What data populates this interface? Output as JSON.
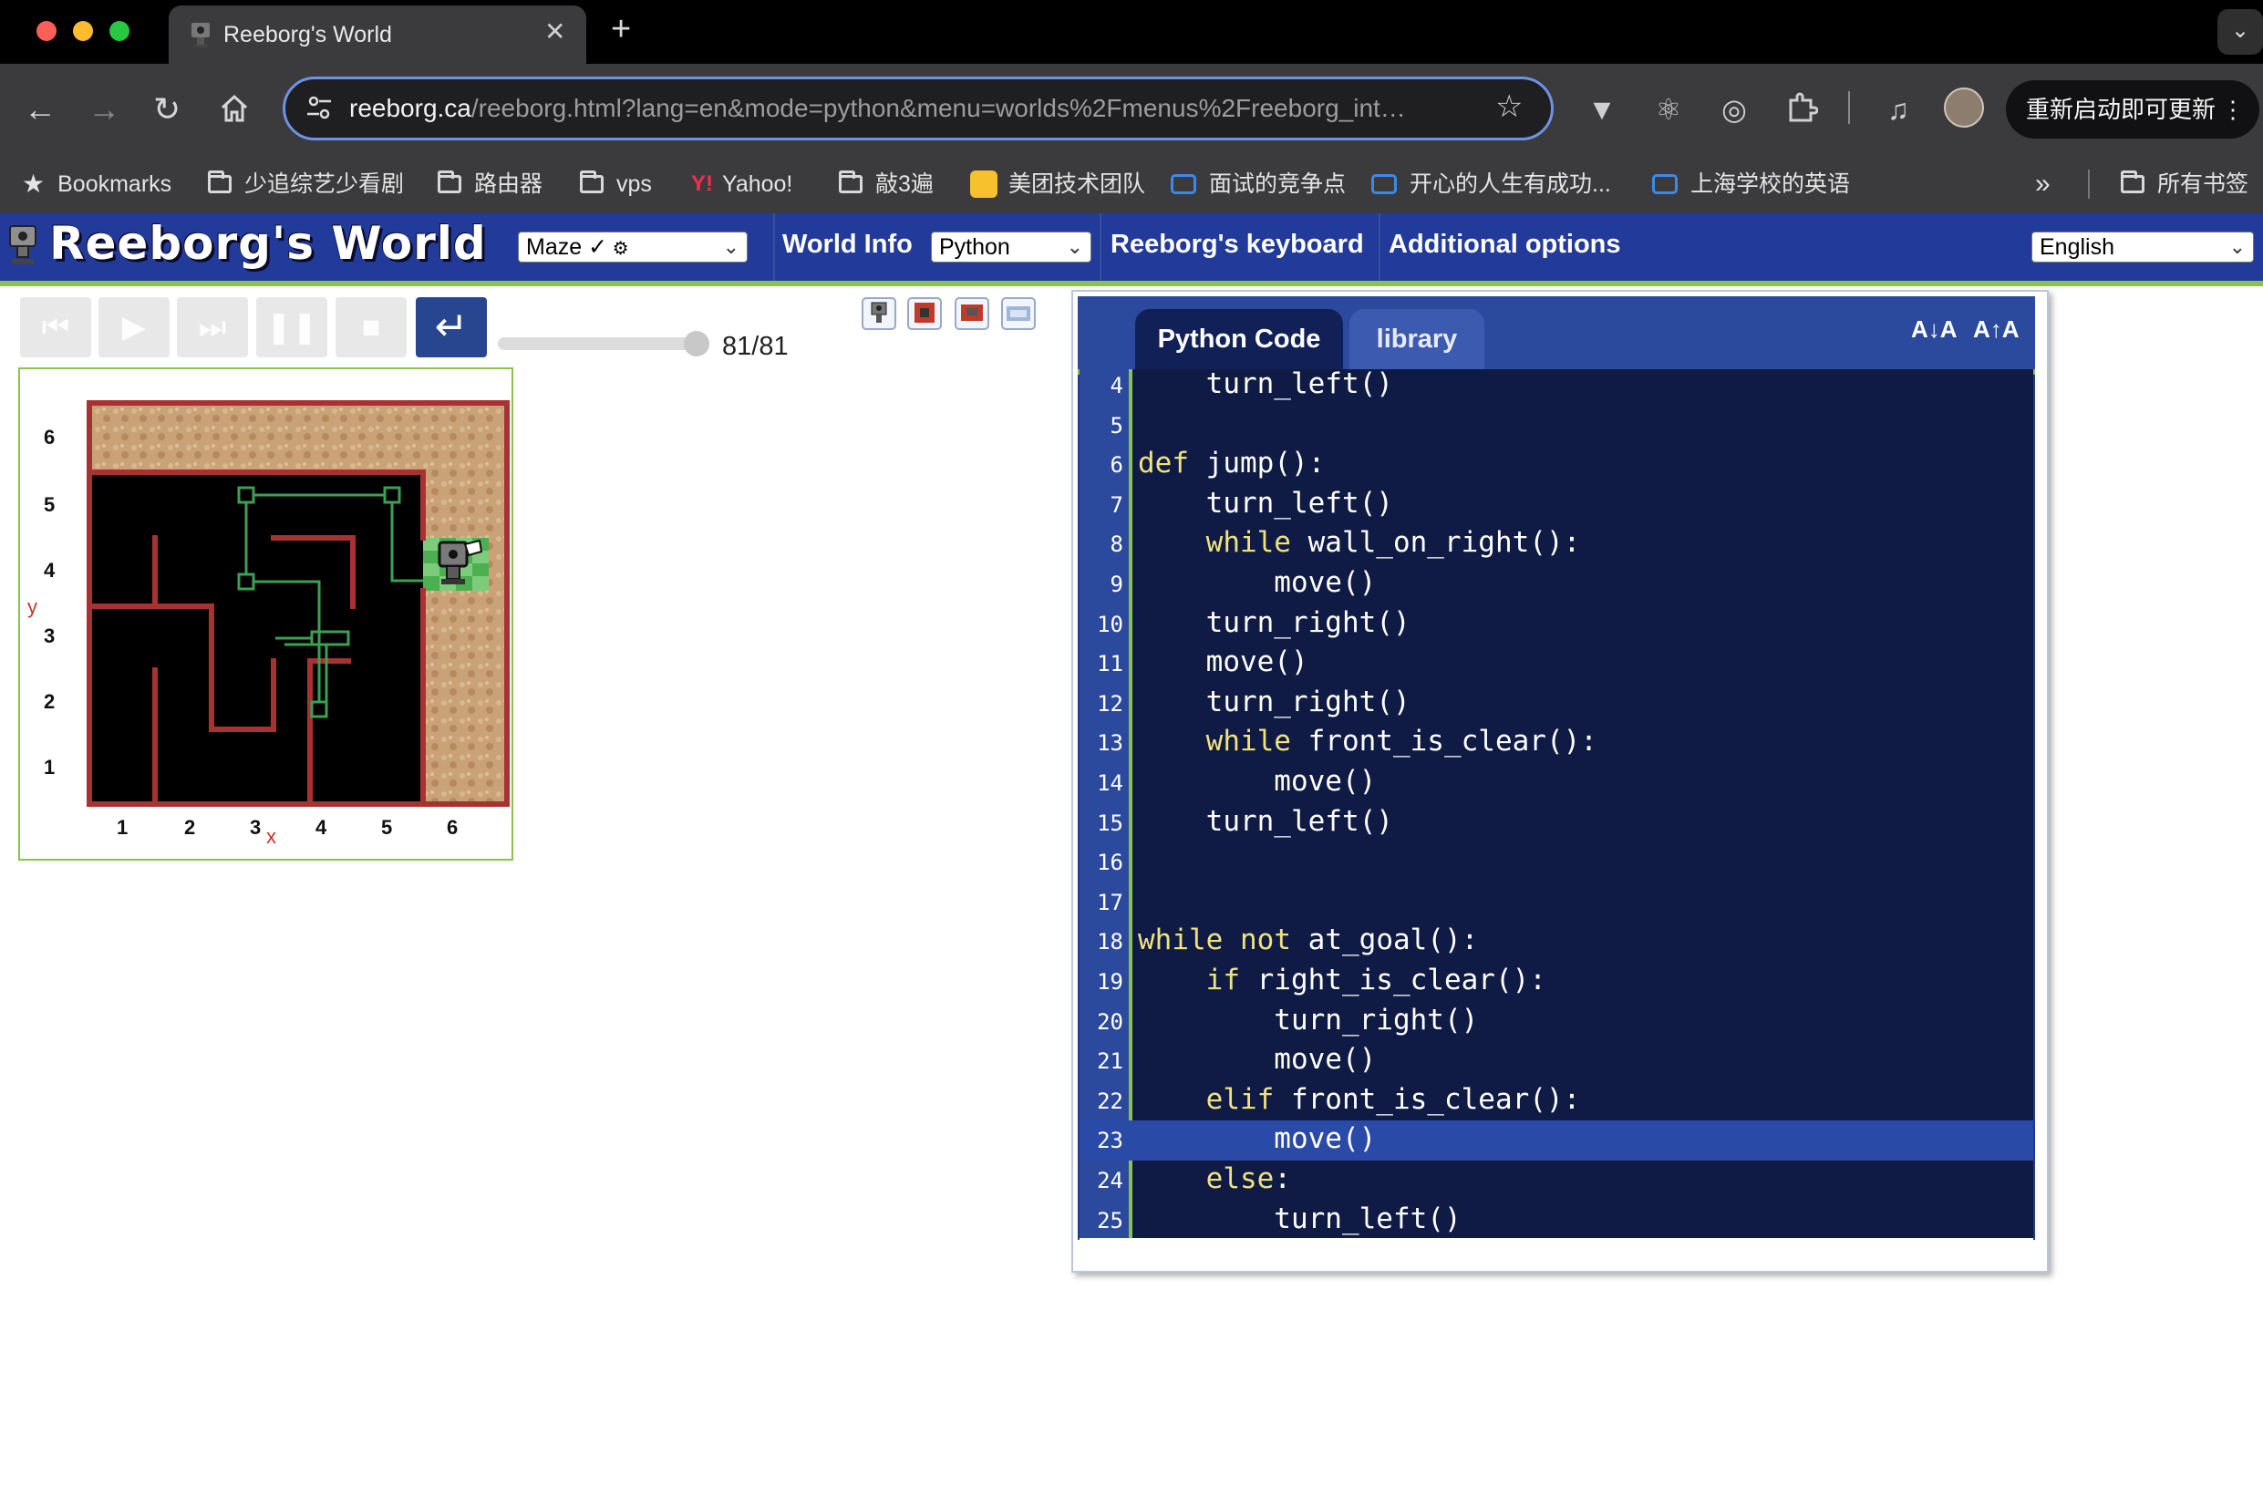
{
  "browser": {
    "tab_title": "Reeborg's World",
    "url_host": "reeborg.ca",
    "url_path": "/reeborg.html?lang=en&mode=python&menu=worlds%2Fmenus%2Freeborg_int…",
    "update_button": "重新启动即可更新",
    "bookmarks": [
      "Bookmarks",
      "少追综艺少看剧",
      "路由器",
      "vps",
      "Yahoo!",
      "敲3遍",
      "美团技术团队",
      "面试的竞争点",
      "开心的人生有成功...",
      "上海学校的英语",
      "所有书签"
    ],
    "overflow_label": "»"
  },
  "app": {
    "logo": "Reeborg's World",
    "world_select": "Maze ✓",
    "world_info": "World Info",
    "language_mode": "Python",
    "keyboard": "Reeborg's keyboard",
    "options": "Additional options",
    "ui_language": "English"
  },
  "controls": {
    "step_counter": "81/81",
    "step_value": 81,
    "step_total": 81
  },
  "world": {
    "y_labels": [
      "6",
      "5",
      "4",
      "3",
      "2",
      "1"
    ],
    "x_labels": [
      "1",
      "2",
      "3",
      "4",
      "5",
      "6"
    ],
    "x_axis": "x",
    "y_axis": "y"
  },
  "editor": {
    "tab_code": "Python Code",
    "tab_library": "library",
    "font_down": "A↓A",
    "font_up": "A↑A",
    "highlighted_line": 23,
    "lines": [
      {
        "n": "4",
        "segs": [
          [
            "",
            "    turn_left()"
          ]
        ]
      },
      {
        "n": "5",
        "segs": [
          [
            "",
            ""
          ]
        ]
      },
      {
        "n": "6",
        "segs": [
          [
            "kw",
            "def"
          ],
          [
            "",
            " jump():"
          ]
        ]
      },
      {
        "n": "7",
        "segs": [
          [
            "",
            "    turn_left()"
          ]
        ]
      },
      {
        "n": "8",
        "segs": [
          [
            "",
            "    "
          ],
          [
            "kw",
            "while"
          ],
          [
            "",
            " wall_on_right():"
          ]
        ]
      },
      {
        "n": "9",
        "segs": [
          [
            "",
            "        move()"
          ]
        ]
      },
      {
        "n": "10",
        "segs": [
          [
            "",
            "    turn_right()"
          ]
        ]
      },
      {
        "n": "11",
        "segs": [
          [
            "",
            "    move()"
          ]
        ]
      },
      {
        "n": "12",
        "segs": [
          [
            "",
            "    turn_right()"
          ]
        ]
      },
      {
        "n": "13",
        "segs": [
          [
            "",
            "    "
          ],
          [
            "kw",
            "while"
          ],
          [
            "",
            " front_is_clear():"
          ]
        ]
      },
      {
        "n": "14",
        "segs": [
          [
            "",
            "        move()"
          ]
        ]
      },
      {
        "n": "15",
        "segs": [
          [
            "",
            "    turn_left()"
          ]
        ]
      },
      {
        "n": "16",
        "segs": [
          [
            "",
            ""
          ]
        ]
      },
      {
        "n": "17",
        "segs": [
          [
            "",
            ""
          ]
        ]
      },
      {
        "n": "18",
        "segs": [
          [
            "kw",
            "while"
          ],
          [
            "",
            " "
          ],
          [
            "kw",
            "not"
          ],
          [
            "",
            " at_goal():"
          ]
        ]
      },
      {
        "n": "19",
        "segs": [
          [
            "",
            "    "
          ],
          [
            "kw",
            "if"
          ],
          [
            "",
            " right_is_clear():"
          ]
        ]
      },
      {
        "n": "20",
        "segs": [
          [
            "",
            "        turn_right()"
          ]
        ]
      },
      {
        "n": "21",
        "segs": [
          [
            "",
            "        move()"
          ]
        ]
      },
      {
        "n": "22",
        "segs": [
          [
            "",
            "    "
          ],
          [
            "kw",
            "elif"
          ],
          [
            "",
            " front_is_clear():"
          ]
        ]
      },
      {
        "n": "23",
        "segs": [
          [
            "",
            "        move()"
          ]
        ]
      },
      {
        "n": "24",
        "segs": [
          [
            "",
            "    "
          ],
          [
            "kw",
            "else"
          ],
          [
            "",
            ":"
          ]
        ]
      },
      {
        "n": "25",
        "segs": [
          [
            "",
            "        turn_left()"
          ]
        ]
      }
    ]
  }
}
